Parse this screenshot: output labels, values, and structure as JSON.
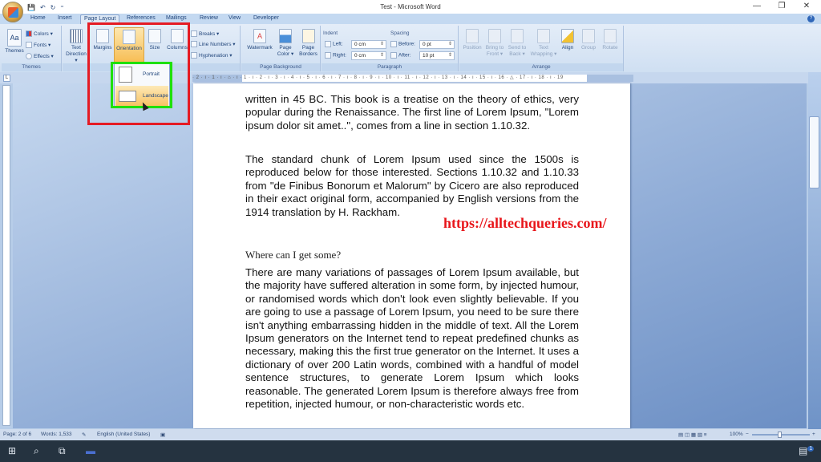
{
  "window": {
    "title": "Test - Microsoft Word",
    "controls": {
      "minimize": "—",
      "restore": "❐",
      "close": "✕"
    }
  },
  "quick_access": {
    "save_icon": "💾",
    "undo_icon": "↶",
    "redo_icon": "↻",
    "customize_icon": "⁼"
  },
  "tabs": [
    "Home",
    "Insert",
    "Page Layout",
    "References",
    "Mailings",
    "Review",
    "View",
    "Developer"
  ],
  "active_tab": "Page Layout",
  "ribbon": {
    "themes": {
      "label": "Themes",
      "themes_button": "Themes",
      "colors": "Colors ▾",
      "fonts": "Fonts ▾",
      "effects": "Effects ▾"
    },
    "page_setup": {
      "text_direction": "Text Direction ▾",
      "margins": "Margins",
      "orientation": "Orientation",
      "size": "Size",
      "columns": "Columns",
      "breaks": "Breaks ▾",
      "line_numbers": "Line Numbers ▾",
      "hyphenation": "Hyphenation ▾"
    },
    "page_background": {
      "label": "Page Background",
      "watermark": "Watermark",
      "page_color": "Page Color ▾",
      "page_borders": "Page Borders"
    },
    "paragraph": {
      "label": "Paragraph",
      "indent_label": "Indent",
      "left_label": "Left:",
      "left_value": "0 cm",
      "right_label": "Right:",
      "right_value": "0 cm",
      "spacing_label": "Spacing",
      "before_label": "Before:",
      "before_value": "0 pt",
      "after_label": "After:",
      "after_value": "10 pt"
    },
    "arrange": {
      "label": "Arrange",
      "position": "Position",
      "bring_to_front": "Bring to Front ▾",
      "send_to_back": "Send to Back ▾",
      "text_wrapping": "Text Wrapping ▾",
      "align": "Align",
      "group": "Group",
      "rotate": "Rotate"
    }
  },
  "orientation_menu": {
    "items": [
      {
        "label": "Portrait",
        "selected": false
      },
      {
        "label": "Landscape",
        "selected": true
      }
    ]
  },
  "ruler": {
    "corner": "L",
    "ticks": "· 2 · ı · 1 · ı · ⌂ · ı · 1 · ı · 2 · ı · 3 · ı · 4 · ı · 5 · ı · 6 · ı · 7 · ı · 8 · ı · 9 · ı · 10 · ı · 11 · ı · 12 · ı · 13 · ı · 14 · ı · 15 · ı · 16 · △ · 17 · ı · 18 · ı · 19"
  },
  "document": {
    "paragraph1": "written in 45 BC. This book is a treatise on the theory of ethics, very popular during the Renaissance. The first line of Lorem Ipsum, \"Lorem ipsum dolor sit amet..\", comes from a line in section 1.10.32.",
    "paragraph2": "The standard chunk of Lorem Ipsum used since the 1500s is reproduced below for those interested. Sections 1.10.32 and 1.10.33 from \"de Finibus Bonorum et Malorum\" by Cicero are also reproduced in their exact original form, accompanied by English versions from the 1914 translation by H. Rackham.",
    "heading": "Where can I get some?",
    "paragraph3": "There are many variations of passages of Lorem Ipsum available, but the majority have suffered alteration in some form, by injected humour, or randomised words which don't look even slightly believable. If you are going to use a passage of Lorem Ipsum, you need to be sure there isn't anything embarrassing hidden in the middle of text. All the Lorem Ipsum generators on the Internet tend to repeat predefined chunks as necessary, making this the first true generator on the Internet. It uses a dictionary of over 200 Latin words, combined with a handful of model sentence structures, to generate Lorem Ipsum which looks reasonable. The generated Lorem Ipsum is therefore always free from repetition, injected humour, or non-characteristic words etc."
  },
  "watermark_overlay": "https://alltechqueries.com/",
  "status_bar": {
    "page": "Page: 2 of 6",
    "words": "Words: 1,533",
    "language": "English (United States)",
    "zoom": "100%",
    "zoom_out": "−",
    "zoom_in": "+"
  },
  "taskbar": {
    "start_icon": "⊞",
    "search_icon": "⌕",
    "taskview_icon": "⧉",
    "notification_count": "1"
  },
  "colors": {
    "highlight_red": "#e51b24",
    "highlight_green": "#1fe000",
    "watermark_red": "#e8151a",
    "ribbon_accent": "#f7be55"
  }
}
